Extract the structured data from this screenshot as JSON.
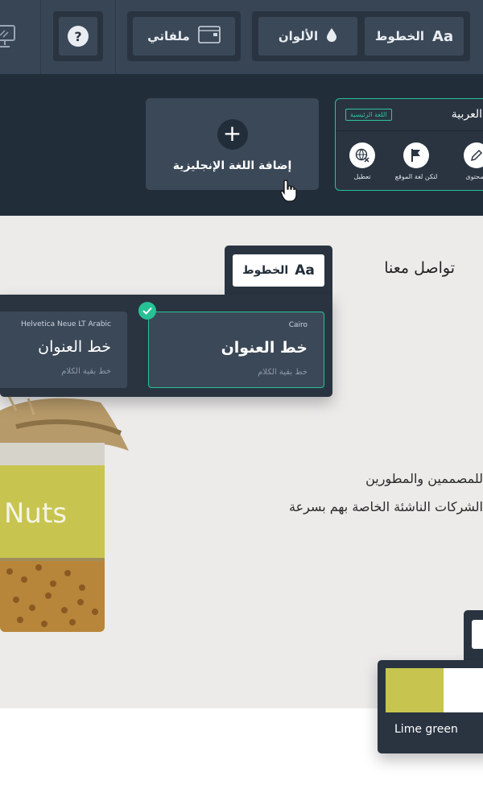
{
  "toolbar": {
    "fonts_label": "الخطوط",
    "fonts_glyph": "Aa",
    "colors_label": "الألوان",
    "files_label": "ملفاتي",
    "help_glyph": "?"
  },
  "languages": {
    "add_english_label": "إضافة اللغة الإنجليزية",
    "add_glyph": "+",
    "arabic": {
      "name": "العربية",
      "badge": "اللغة الرئيسية",
      "actions": [
        "المحتوى",
        "لتكن لغة الموقع",
        "تعطيل"
      ]
    }
  },
  "page": {
    "contact": "تواصل معنا",
    "description_line1": "للمصممين والمطورين",
    "description_line2": "الشركات الناشئة الخاصة بهم بسرعة",
    "product_label": "Nuts"
  },
  "fonts_popover": {
    "tab_label": "الخطوط",
    "tab_glyph": "Aa",
    "options": [
      {
        "font_name": "Cairo",
        "heading": "خط العنوان",
        "body": "خط بقية الكلام",
        "selected": true
      },
      {
        "font_name": "Helvetica Neue LT Arabic",
        "heading": "خط العنوان",
        "body": "خط بقية الكلام",
        "selected": false
      }
    ]
  },
  "color_popover": {
    "color_name": "Lime green",
    "colors": {
      "primary": "#c7c54f",
      "secondary": "#ffffff"
    }
  },
  "theme": {
    "accent": "#27c196",
    "dark": "#222d3a",
    "panel": "#2a3441",
    "card": "#3b4858"
  }
}
